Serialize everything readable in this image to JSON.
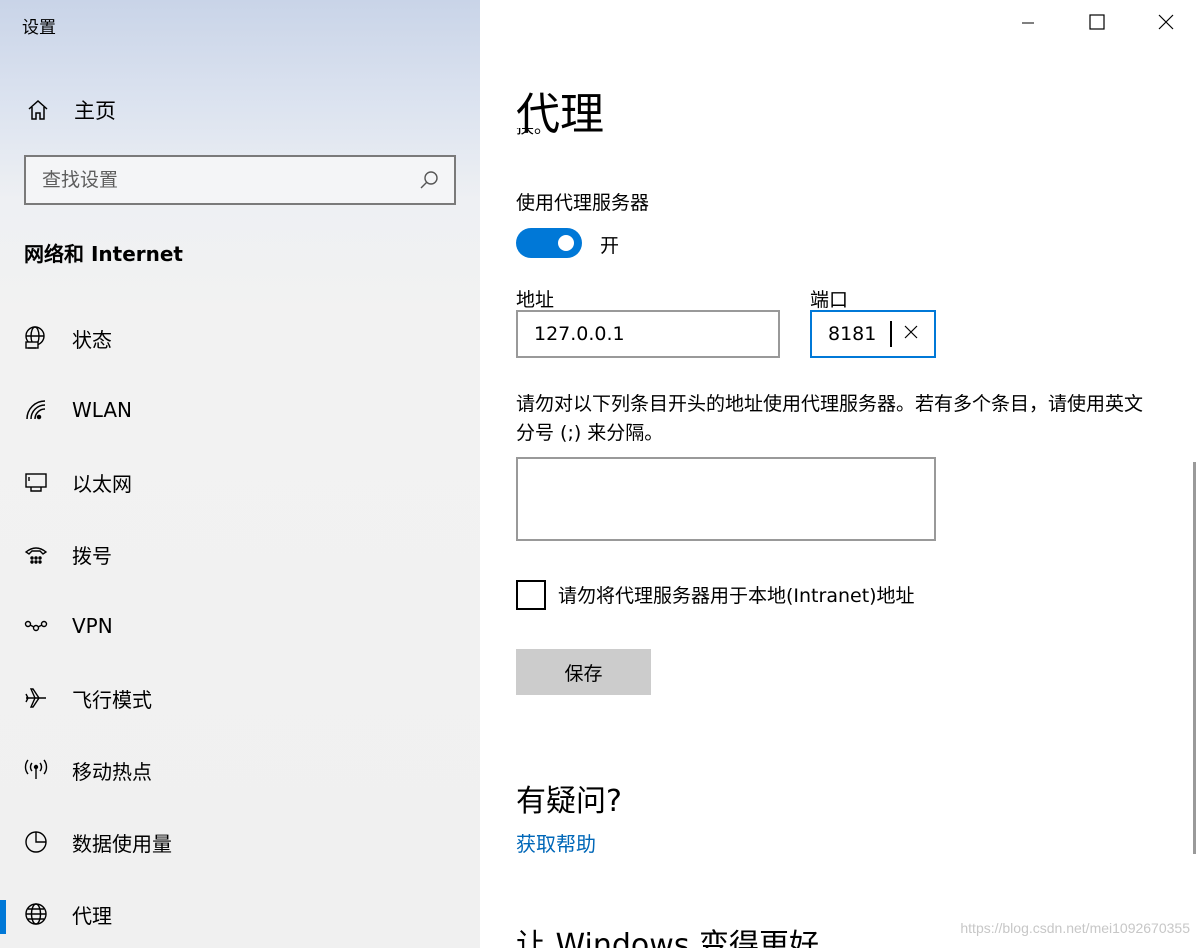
{
  "app_title": "设置",
  "window_controls": [
    "minimize",
    "maximize",
    "close"
  ],
  "sidebar": {
    "home_label": "主页",
    "search_placeholder": "查找设置",
    "section_heading": "网络和 Internet",
    "items": [
      {
        "label": "状态",
        "icon": "globe-status-icon"
      },
      {
        "label": "WLAN",
        "icon": "wifi-icon"
      },
      {
        "label": "以太网",
        "icon": "ethernet-icon"
      },
      {
        "label": "拨号",
        "icon": "dialup-icon"
      },
      {
        "label": "VPN",
        "icon": "vpn-icon"
      },
      {
        "label": "飞行模式",
        "icon": "airplane-icon"
      },
      {
        "label": "移动热点",
        "icon": "hotspot-icon"
      },
      {
        "label": "数据使用量",
        "icon": "data-usage-icon"
      },
      {
        "label": "代理",
        "icon": "globe-icon",
        "active": true
      }
    ]
  },
  "main": {
    "title": "代理",
    "cut_text": "换。",
    "use_proxy_label": "使用代理服务器",
    "toggle_state": "开",
    "address_label": "地址",
    "address_value": "127.0.0.1",
    "port_label": "端口",
    "port_value": "8181",
    "exceptions_description": "请勿对以下列条目开头的地址使用代理服务器。若有多个条目，请使用英文分号 (;) 来分隔。",
    "exceptions_value": "",
    "local_checkbox_label": "请勿将代理服务器用于本地(Intranet)地址",
    "local_checkbox_checked": false,
    "save_label": "保存",
    "help_heading": "有疑问?",
    "help_link": "获取帮助",
    "bottom_heading": "让 Windows 变得更好"
  },
  "watermark": "https://blog.csdn.net/mei1092670355",
  "colors": {
    "accent": "#0078d7",
    "link": "#0067b8",
    "button_bg": "#cccccc"
  }
}
